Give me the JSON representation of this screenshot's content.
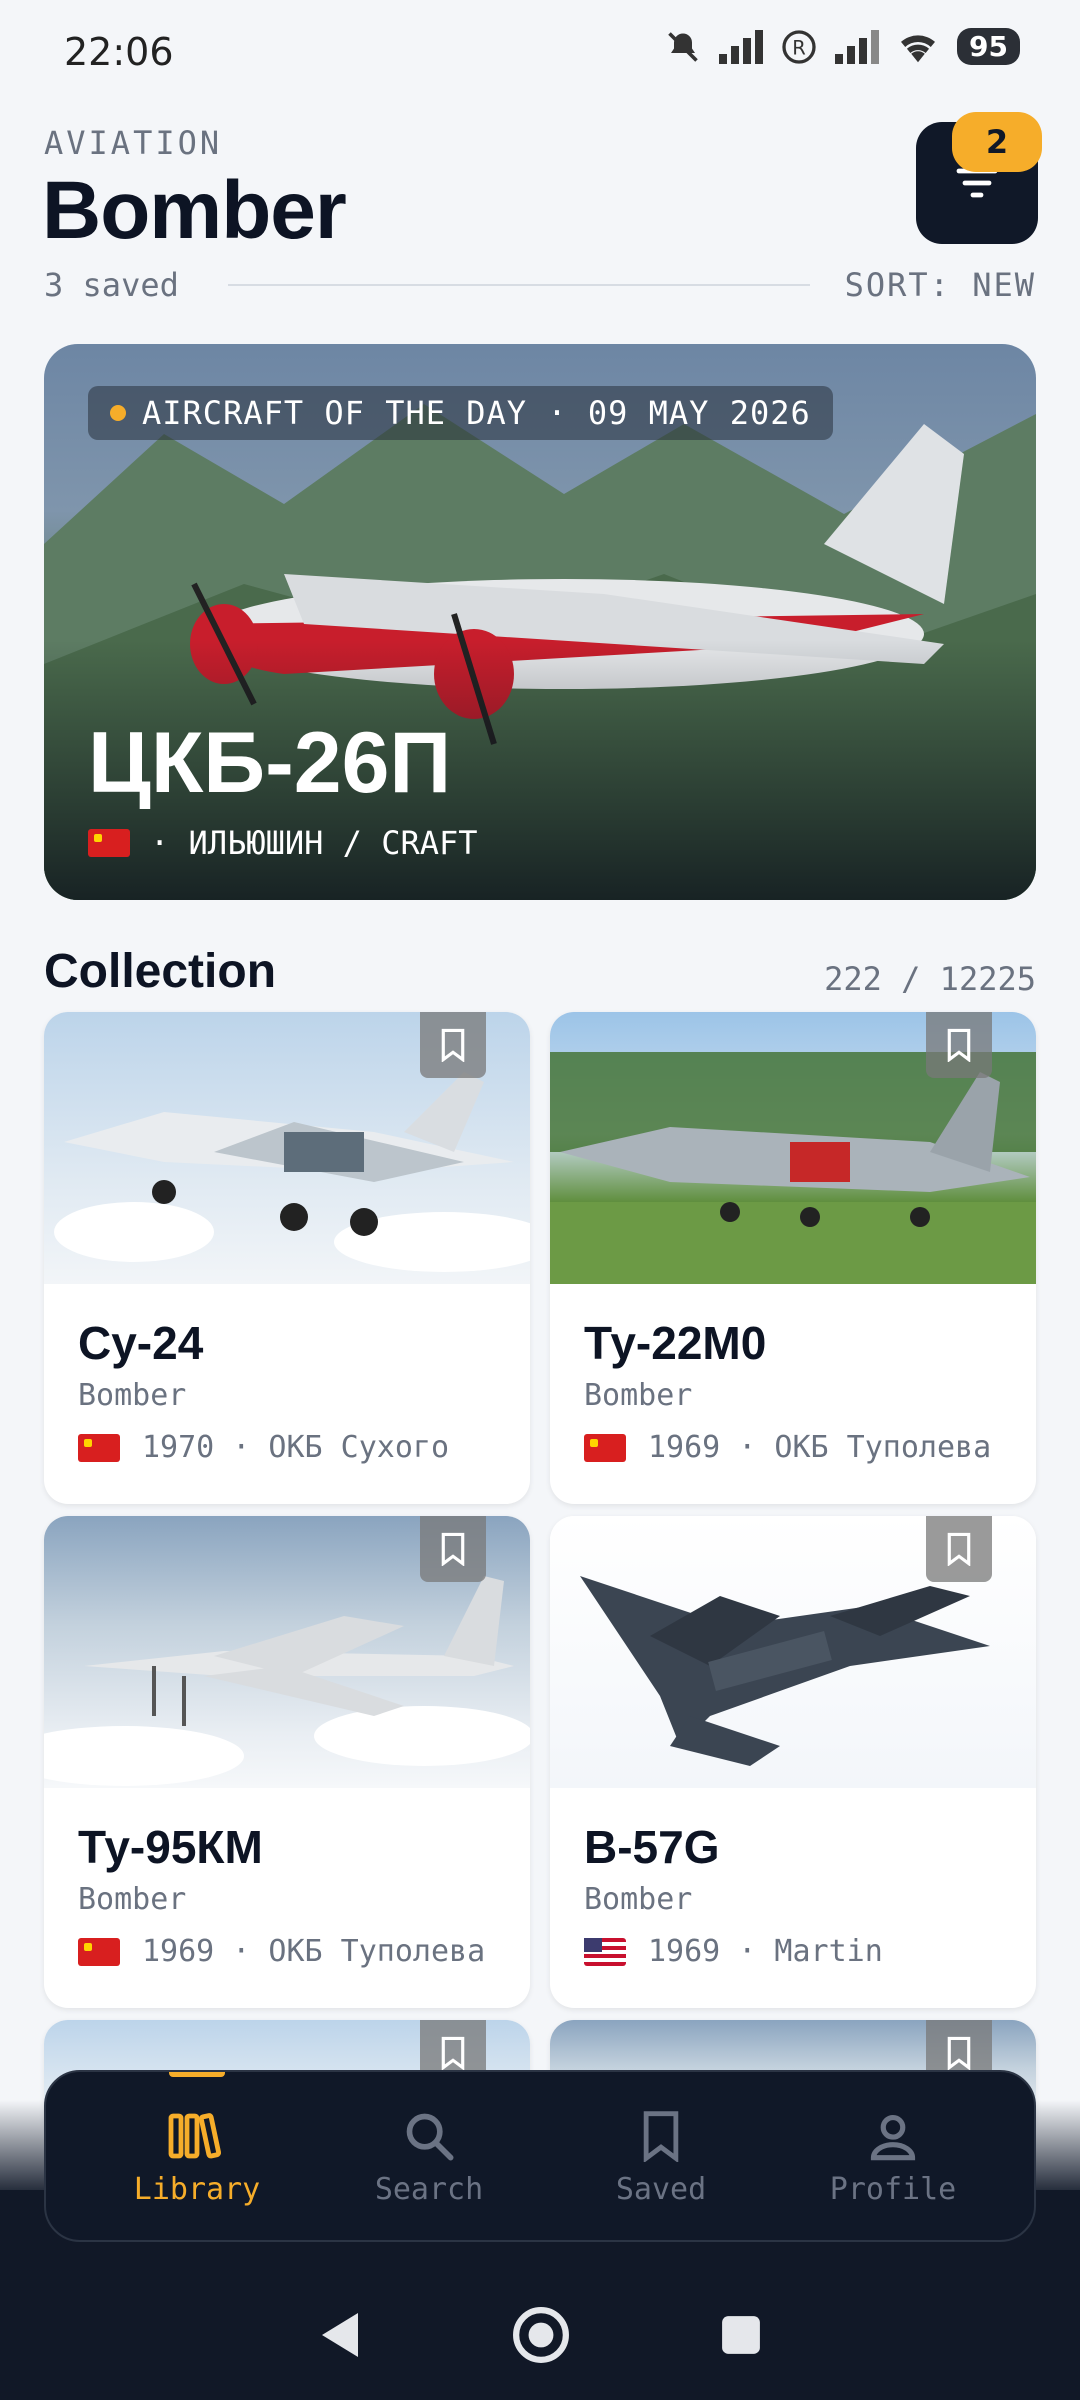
{
  "status_bar": {
    "time": "22:06",
    "battery": "95"
  },
  "header": {
    "eyebrow": "AVIATION",
    "title": "Bomber",
    "saved_count": "3 saved",
    "sort_label": "SORT: NEW",
    "filter_badge": "2"
  },
  "hero": {
    "chip": "AIRCRAFT OF THE DAY · 09 MAY 2026",
    "title": "ЦКБ-26П",
    "meta": "· ИЛЬЮШИН / CRAFT",
    "flag": "cn-flag"
  },
  "collection": {
    "title": "Collection",
    "count": "222 / 12225",
    "cards": [
      {
        "title": "Су-24",
        "category": "Bomber",
        "meta": "1970 · ОКБ Сухого",
        "flag": "cn-flag"
      },
      {
        "title": "Ту-22М0",
        "category": "Bomber",
        "meta": "1969 · ОКБ Туполева",
        "flag": "cn-flag"
      },
      {
        "title": "Ту-95КМ",
        "category": "Bomber",
        "meta": "1969 · ОКБ Туполева",
        "flag": "cn-flag"
      },
      {
        "title": "B-57G",
        "category": "Bomber",
        "meta": "1969 · Martin",
        "flag": "us-flag"
      }
    ]
  },
  "bottom_nav": {
    "items": [
      {
        "label": "Library",
        "icon": "library-icon",
        "active": true
      },
      {
        "label": "Search",
        "icon": "search-icon",
        "active": false
      },
      {
        "label": "Saved",
        "icon": "bookmark-icon",
        "active": false
      },
      {
        "label": "Profile",
        "icon": "profile-icon",
        "active": false
      }
    ]
  },
  "colors": {
    "accent": "#f6ad2a",
    "dark": "#101828",
    "background": "#f4f6f9"
  }
}
